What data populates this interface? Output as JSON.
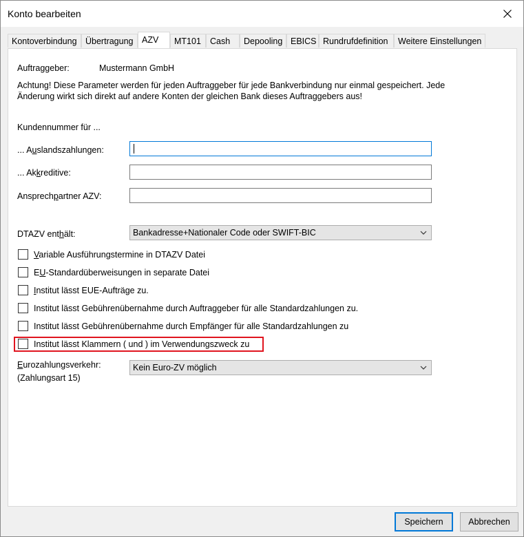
{
  "window": {
    "title": "Konto bearbeiten"
  },
  "tabs": [
    {
      "label": "Kontoverbindung"
    },
    {
      "label": "Übertragung"
    },
    {
      "label": "AZV"
    },
    {
      "label": "MT101"
    },
    {
      "label": "Cash"
    },
    {
      "label": "Depooling"
    },
    {
      "label": "EBICS"
    },
    {
      "label": "Rundrufdefinition"
    },
    {
      "label": "Weitere Einstellungen"
    }
  ],
  "azv": {
    "auftraggeber_label": "Auftraggeber:",
    "auftraggeber_value": "Mustermann GmbH",
    "notice_line1": "Achtung! Diese Parameter werden für jeden Auftraggeber für jede Bankverbindung nur einmal gespeichert. Jede",
    "notice_line2": "Änderung wirkt sich direkt auf andere Konten der gleichen Bank dieses Auftraggebers aus!",
    "kundennummer_heading": "Kundennummer für ...",
    "auslandszahlungen": {
      "pre": "... A",
      "ul": "u",
      "post": "slandszahlungen:",
      "value": ""
    },
    "akkreditive": {
      "pre": "... Ak",
      "ul": "k",
      "post": "reditive:",
      "value": ""
    },
    "ansprechpartner": {
      "pre": "Ansprech",
      "ul": "p",
      "post": "artner AZV:",
      "value": ""
    },
    "dtazv": {
      "pre": "DTAZV ent",
      "ul": "h",
      "post": "ält:",
      "selected": "Bankadresse+Nationaler Code oder SWIFT-BIC"
    },
    "checkboxes": [
      {
        "pre": "",
        "ul": "V",
        "post": "ariable Ausführungstermine in DTAZV Datei",
        "checked": false
      },
      {
        "pre": "E",
        "ul": "U",
        "post": "-Standardüberweisungen in separate Datei",
        "checked": false
      },
      {
        "pre": "",
        "ul": "I",
        "post": "nstitut lässt EUE-Aufträge zu.",
        "checked": false
      },
      {
        "pre": "Institut lässt Gebührenübernahme durch Auftraggeber für alle Standardzahlungen zu.",
        "ul": "",
        "post": "",
        "checked": false
      },
      {
        "pre": "Institut lässt Gebührenübernahme durch Empfänger für alle Standardzahlungen zu",
        "ul": "",
        "post": "",
        "checked": false
      },
      {
        "pre": "Institut lässt Klammern ( und ) im Verwendungszweck zu",
        "ul": "",
        "post": "",
        "checked": false
      }
    ],
    "euro": {
      "pre": "",
      "ul": "E",
      "post": "urozahlungsverkehr:",
      "line2": "(Zahlungsart 15)",
      "selected": "Kein Euro-ZV möglich"
    }
  },
  "buttons": {
    "save": "Speichern",
    "cancel": "Abbrechen"
  },
  "colors": {
    "highlight": "#e0141e",
    "focus": "#0078d7"
  }
}
